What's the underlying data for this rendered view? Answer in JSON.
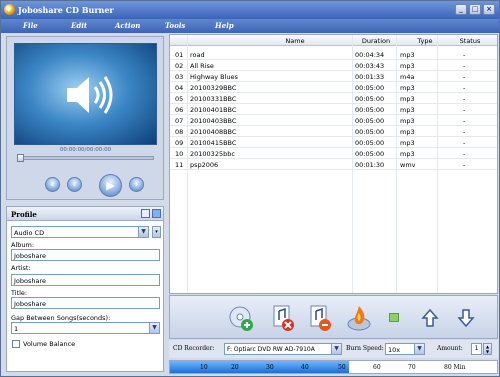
{
  "window": {
    "title": "Joboshare CD Burner"
  },
  "title_buttons": {
    "minimize": "_",
    "maximize": "□",
    "close": "×"
  },
  "menu": [
    {
      "label": "File"
    },
    {
      "label": "Edit"
    },
    {
      "label": "Action"
    },
    {
      "label": "Tools"
    },
    {
      "label": "Help"
    }
  ],
  "player": {
    "time": "00:00:00/00:00:00",
    "seek_position": 0,
    "controls": {
      "prev_icon": "rewind-icon",
      "play_icon": "play-icon",
      "stop_icon": "stop-icon",
      "next_icon": "fast-forward-icon"
    },
    "display_icon": "speaker-icon"
  },
  "profile": {
    "title": "Profile",
    "type_value": "Audio CD",
    "album_label": "Album:",
    "album_value": "Joboshare",
    "artist_label": "Artist:",
    "artist_value": "Joboshare",
    "title_label": "Title:",
    "title_value": "Joboshare",
    "gap_label": "Gap Between Songs(seconds):",
    "gap_value": "1",
    "volume_balance_label": "Volume Balance",
    "volume_balance_checked": false
  },
  "table": {
    "columns": [
      "Name",
      "Duration",
      "Type",
      "Status"
    ],
    "rows": [
      {
        "num": "01",
        "name": "road",
        "duration": "00:04:34",
        "type": "mp3",
        "status": "-"
      },
      {
        "num": "02",
        "name": "All Rise",
        "duration": "00:03:43",
        "type": "mp3",
        "status": "-"
      },
      {
        "num": "03",
        "name": "Highway Blues",
        "duration": "00:01:33",
        "type": "m4a",
        "status": "-"
      },
      {
        "num": "04",
        "name": "20100329BBC",
        "duration": "00:05:00",
        "type": "mp3",
        "status": "-"
      },
      {
        "num": "05",
        "name": "20100331BBC",
        "duration": "00:05:00",
        "type": "mp3",
        "status": "-"
      },
      {
        "num": "06",
        "name": "20100401BBC",
        "duration": "00:05:00",
        "type": "mp3",
        "status": "-"
      },
      {
        "num": "07",
        "name": "20100403BBC",
        "duration": "00:05:00",
        "type": "mp3",
        "status": "-"
      },
      {
        "num": "08",
        "name": "20100408BBC",
        "duration": "00:05:00",
        "type": "mp3",
        "status": "-"
      },
      {
        "num": "09",
        "name": "20100415BBC",
        "duration": "00:05:00",
        "type": "mp3",
        "status": "-"
      },
      {
        "num": "10",
        "name": "20100325bbc",
        "duration": "00:05:00",
        "type": "mp3",
        "status": "-"
      },
      {
        "num": "11",
        "name": "psp2006",
        "duration": "00:01:30",
        "type": "wmv",
        "status": "-"
      }
    ]
  },
  "toolbar": {
    "add_icon": "add-file-icon",
    "remove_icon": "remove-file-icon",
    "clear_icon": "clear-list-icon",
    "burn_icon": "burn-disc-icon",
    "info_icon": "info-icon",
    "up_icon": "move-up-icon",
    "down_icon": "move-down-icon"
  },
  "burn": {
    "recorder_label": "CD Recorder:",
    "recorder_value": "F: Optiarc DVD RW AD-7910A",
    "speed_label": "Burn Speed:",
    "speed_value": "10x",
    "amount_label": "Amount:",
    "amount_value": "1"
  },
  "capacity": {
    "ticks": [
      "10",
      "20",
      "30",
      "40",
      "50",
      "60",
      "70",
      "80 Min"
    ],
    "used_minutes": 46
  },
  "colors": {
    "title_bar": "#3a64b8",
    "capacity_fill": "#1d6fd6",
    "window_bg": "#d4dbe8"
  }
}
